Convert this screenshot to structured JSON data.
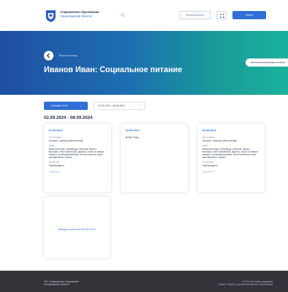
{
  "header": {
    "brand_line1": "Современное образование",
    "brand_line2": "Ленинградской области",
    "search_placeholder": "",
    "outline_button": "Личный кабинет",
    "primary_button": "Войти"
  },
  "banner": {
    "breadcrumb": "Вернуться назад",
    "title": "Иванов Иван: Социальное питание",
    "right_button": "Автоматический режим питания"
  },
  "filters": {
    "month": "Сентябрь 2024",
    "week": "02.09.2024 - 08.09.2024"
  },
  "range_title": "02.09.2024 - 08.09.2024",
  "cards": [
    {
      "date": "02.09.2024",
      "type_label": "Тип питания",
      "type_value": "Питание «Завтрак»(бесплатный)",
      "menu_label": "Меню",
      "menu_value": "Каша молочная, бутерброд с маслом, какао с молоком, хлеб пшеничный, фрукты, салат из свежих овощей, суп вермишелевый, котлета мясная, пюре картофельное, компот",
      "status_label": "Получение",
      "status_value": "Подтверждено",
      "link": "Подробнее"
    },
    {
      "date": "03.09.2024",
      "type_label": "",
      "type_value": "Выбор блюд",
      "menu_label": "",
      "menu_value": "",
      "status_label": "",
      "status_value": "",
      "link": ""
    },
    {
      "date": "04.09.2024",
      "type_label": "Тип питания",
      "type_value": "Питание «Завтрак»(бесплатный)",
      "menu_label": "Меню",
      "menu_value": "Каша молочная, бутерброд с маслом, какао с молоком, хлеб пшеничный, фрукты, салат из свежих овощей, суп вермишелевый, котлета мясная, пюре картофельное, компот",
      "status_label": "Получение",
      "status_value": "Подтверждено",
      "link": "Подробнее"
    }
  ],
  "add_card": {
    "text": "Выбрать меню на 05.09.2024"
  },
  "footer": {
    "left_line1": "ГИС «Современное образование",
    "left_line2": "Ленинградской области»",
    "right_line1": "© 2024. Все права защищены",
    "right_line2": "Комитет общего и профессионального образования"
  },
  "colors": {
    "accent": "#2f6fd6",
    "banner_start": "#1f4fa3",
    "banner_end": "#1bb19b",
    "footer": "#33343a"
  }
}
